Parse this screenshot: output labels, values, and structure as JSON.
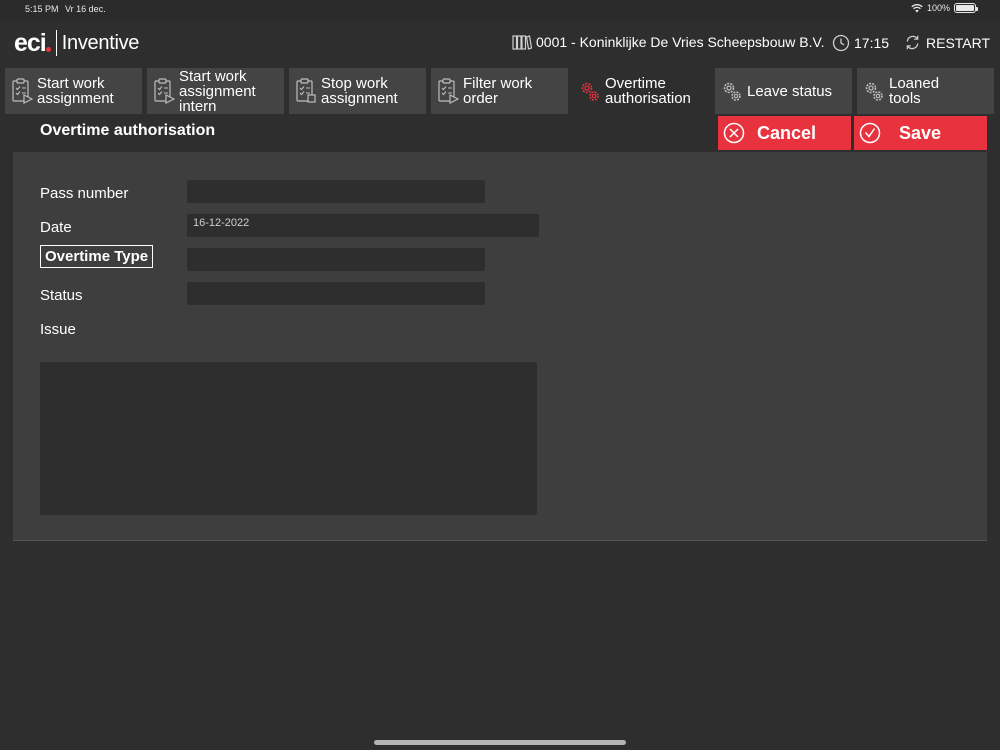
{
  "statusbar": {
    "time": "5:15 PM",
    "date": "Vr 16 dec.",
    "battery": "100%"
  },
  "header": {
    "logo_primary": "eci",
    "logo_secondary": "Inventive",
    "company": "0001 - Koninklijke De Vries Scheepsbouw B.V.",
    "time": "17:15",
    "restart_label": "RESTART"
  },
  "tabs": [
    {
      "label": "Start work\nassignment",
      "icon": "clipboard-play-icon"
    },
    {
      "label": "Start work\nassignment\nintern",
      "icon": "clipboard-play-icon"
    },
    {
      "label": "Stop work\nassignment",
      "icon": "clipboard-stop-icon"
    },
    {
      "label": "Filter work\norder",
      "icon": "clipboard-play-icon"
    },
    {
      "label": "Overtime\nauthorisation",
      "icon": "gears-icon",
      "active": true
    },
    {
      "label": "Leave status",
      "icon": "gears-icon"
    },
    {
      "label": "Loaned\ntools",
      "icon": "gears-icon"
    }
  ],
  "page": {
    "title": "Overtime authorisation",
    "cancel_label": "Cancel",
    "save_label": "Save"
  },
  "form": {
    "pass_number_label": "Pass number",
    "pass_number_value": "",
    "date_label": "Date",
    "date_value": "16-12-2022",
    "overtime_type_label": "Overtime Type",
    "overtime_type_value": "",
    "status_label": "Status",
    "status_value": "",
    "issue_label": "Issue",
    "issue_value": ""
  },
  "colors": {
    "accent": "#e8333f",
    "background": "#2e2e2e",
    "panel": "#3e3e3e",
    "tab_inactive": "#444444"
  }
}
